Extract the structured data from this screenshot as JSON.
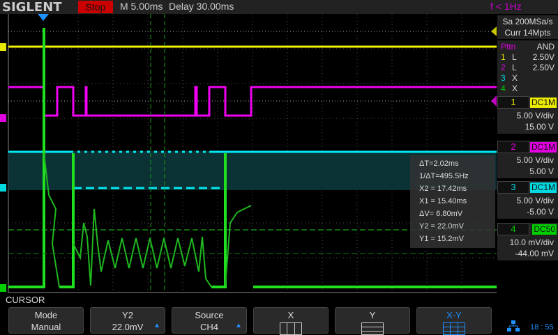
{
  "header": {
    "brand": "SIGLENT",
    "run_state": "Stop",
    "timebase": "M 5.00ms",
    "delay": "Delay 30.00ms",
    "trigger_freq": "f < 1Hz"
  },
  "acquisition": {
    "sample_rate": "Sa 200MSa/s",
    "memory": "Curr 14Mpts"
  },
  "pattern": {
    "title": "Pttn",
    "mode": "AND",
    "rows": [
      {
        "ch": "1",
        "state": "L",
        "level": "2.50V"
      },
      {
        "ch": "2",
        "state": "L",
        "level": "2.50V"
      },
      {
        "ch": "3",
        "state": "X",
        "level": ""
      },
      {
        "ch": "4",
        "state": "X",
        "level": ""
      }
    ]
  },
  "channels": [
    {
      "num": "1",
      "coupling": "DC1M",
      "scale": "5.00 V/div",
      "offset": "15.00 V",
      "color": "#e8e800"
    },
    {
      "num": "2",
      "coupling": "DC1M",
      "scale": "5.00 V/div",
      "offset": "5.00 V",
      "color": "#e000e0"
    },
    {
      "num": "3",
      "coupling": "DC1M",
      "scale": "5.00 V/div",
      "offset": "-5.00 V",
      "color": "#00d8e0"
    },
    {
      "num": "4",
      "coupling": "DC50",
      "scale": "10.0 mV/div",
      "offset": "-44.00 mV",
      "color": "#00d000"
    }
  ],
  "cursor": {
    "dT": "ΔT=2.02ms",
    "inv_dT": "1/ΔT=495.5Hz",
    "x2": "X2 = 17.42ms",
    "x1": "X1 = 15.40ms",
    "dV": "ΔV= 6.80mV",
    "y2": "Y2 = 22.0mV",
    "y1": "Y1 = 15.2mV"
  },
  "menu": {
    "title": "CURSOR",
    "softkeys": [
      {
        "top": "Mode",
        "bottom": "Manual"
      },
      {
        "top": "Y2",
        "bottom": "22.0mV"
      },
      {
        "top": "Source",
        "bottom": "CH4"
      },
      {
        "top": "X",
        "bottom": ""
      },
      {
        "top": "Y",
        "bottom": ""
      },
      {
        "top": "X-Y",
        "bottom": ""
      }
    ]
  },
  "status": {
    "time": "18 : 55"
  }
}
